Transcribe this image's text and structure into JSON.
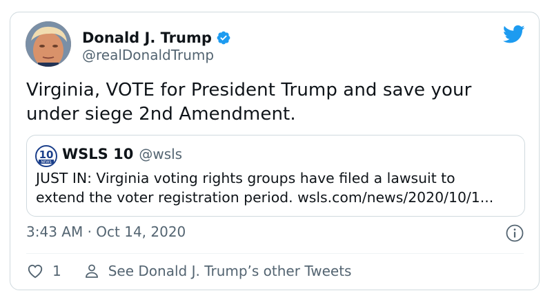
{
  "author": {
    "name": "Donald J. Trump",
    "handle": "@realDonaldTrump",
    "verified": true,
    "avatar_icon": "profile-photo"
  },
  "tweet": {
    "lines": [
      "Virginia, VOTE for President Trump and save your",
      "under siege 2nd Amendment."
    ]
  },
  "quoted": {
    "name": "WSLS 10",
    "handle": "@wsls",
    "logo_icon": "wsls-10-news-logo",
    "logo_text": "10 NEWS",
    "lines": [
      "JUST IN: Virginia voting rights groups have filed a lawsuit to",
      "extend the voter registration period. wsls.com/news/2020/10/1..."
    ]
  },
  "timestamp": "3:43 AM · Oct 14, 2020",
  "actions": {
    "like_count": "1",
    "profile_link": "See Donald J. Trump’s other Tweets"
  },
  "colors": {
    "twitter_blue": "#1d9bf0",
    "secondary_text": "#536471",
    "border": "#cfd9de"
  }
}
